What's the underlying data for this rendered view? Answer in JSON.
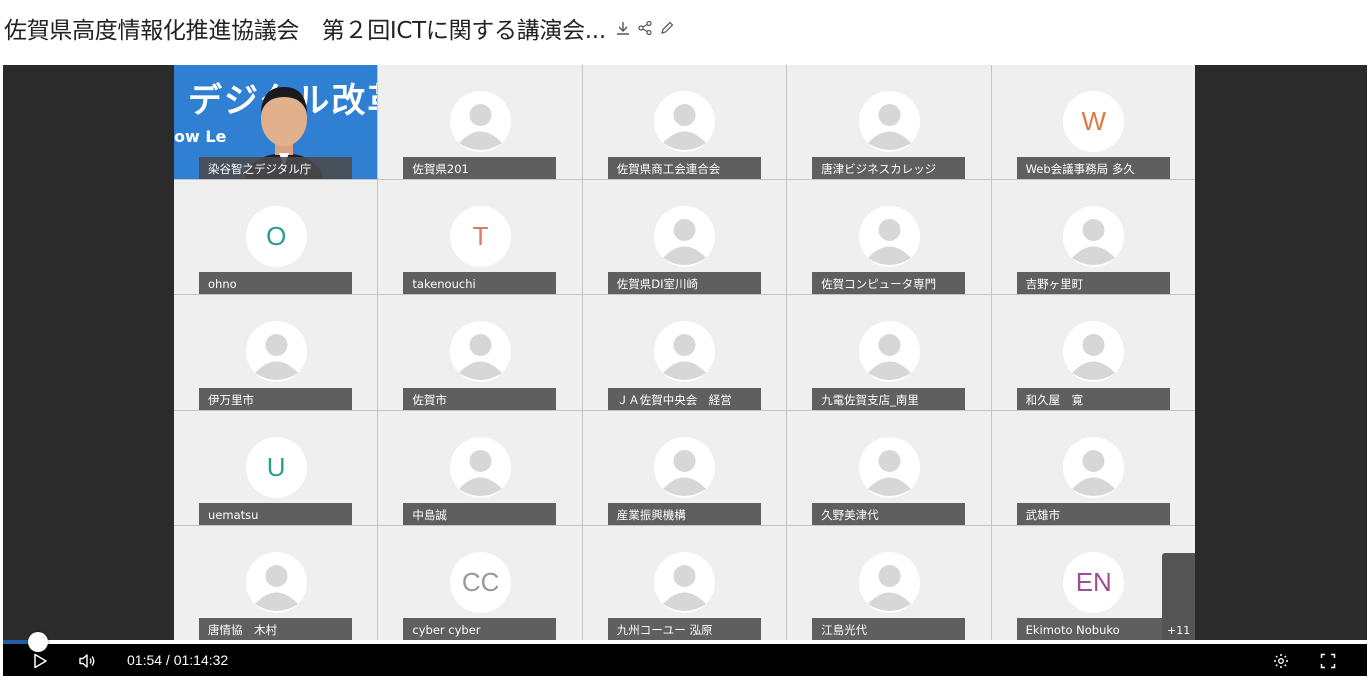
{
  "page": {
    "title": "佐賀県高度情報化推進協議会　第２回ICTに関する講演会..."
  },
  "title_actions": [
    {
      "icon": "download-icon"
    },
    {
      "icon": "share-icon"
    },
    {
      "icon": "pencil-icon"
    }
  ],
  "video": {
    "participants": [
      {
        "name": "染谷智之デジタル庁",
        "type": "video"
      },
      {
        "name": "佐賀県201",
        "type": "default"
      },
      {
        "name": "佐賀県商工会連合会",
        "type": "default"
      },
      {
        "name": "唐津ビジネスカレッジ",
        "type": "default"
      },
      {
        "name": "Web会議事務局 多久",
        "type": "initial",
        "initial": "W",
        "color": "#e07a3f"
      },
      {
        "name": "ohno",
        "type": "initial",
        "initial": "O",
        "color": "#2a9d8f"
      },
      {
        "name": "takenouchi",
        "type": "initial",
        "initial": "T",
        "color": "#e07a5f"
      },
      {
        "name": "佐賀県DI室川崎",
        "type": "default"
      },
      {
        "name": "佐賀コンピュータ専門",
        "type": "default"
      },
      {
        "name": "吉野ヶ里町",
        "type": "default"
      },
      {
        "name": "伊万里市",
        "type": "default"
      },
      {
        "name": "佐賀市",
        "type": "default"
      },
      {
        "name": "ＪＡ佐賀中央会　経営",
        "type": "default"
      },
      {
        "name": "九電佐賀支店_南里",
        "type": "default"
      },
      {
        "name": "和久屋　寛",
        "type": "default"
      },
      {
        "name": "uematsu",
        "type": "initial",
        "initial": "U",
        "color": "#2a9d8f"
      },
      {
        "name": "中島誠",
        "type": "default"
      },
      {
        "name": "産業振興機構",
        "type": "default"
      },
      {
        "name": "久野美津代",
        "type": "default"
      },
      {
        "name": "武雄市",
        "type": "default"
      },
      {
        "name": "唐情協　木村",
        "type": "default"
      },
      {
        "name": "cyber cyber",
        "type": "initial",
        "initial": "CC",
        "color": "#999999"
      },
      {
        "name": "九州コーユー 泓原",
        "type": "default"
      },
      {
        "name": "江島光代",
        "type": "default"
      },
      {
        "name": "Ekimoto Nobuko",
        "type": "initial",
        "initial": "EN",
        "color": "#9b4f96"
      }
    ],
    "banner_text": "デジタル改革",
    "banner_subtext": "ow Le",
    "more_count": "+11"
  },
  "player": {
    "time": "01:54 / 01:14:32",
    "progress": 0.0255,
    "colors": {
      "progress": "#1e5fa8",
      "bar": "#000000"
    }
  }
}
